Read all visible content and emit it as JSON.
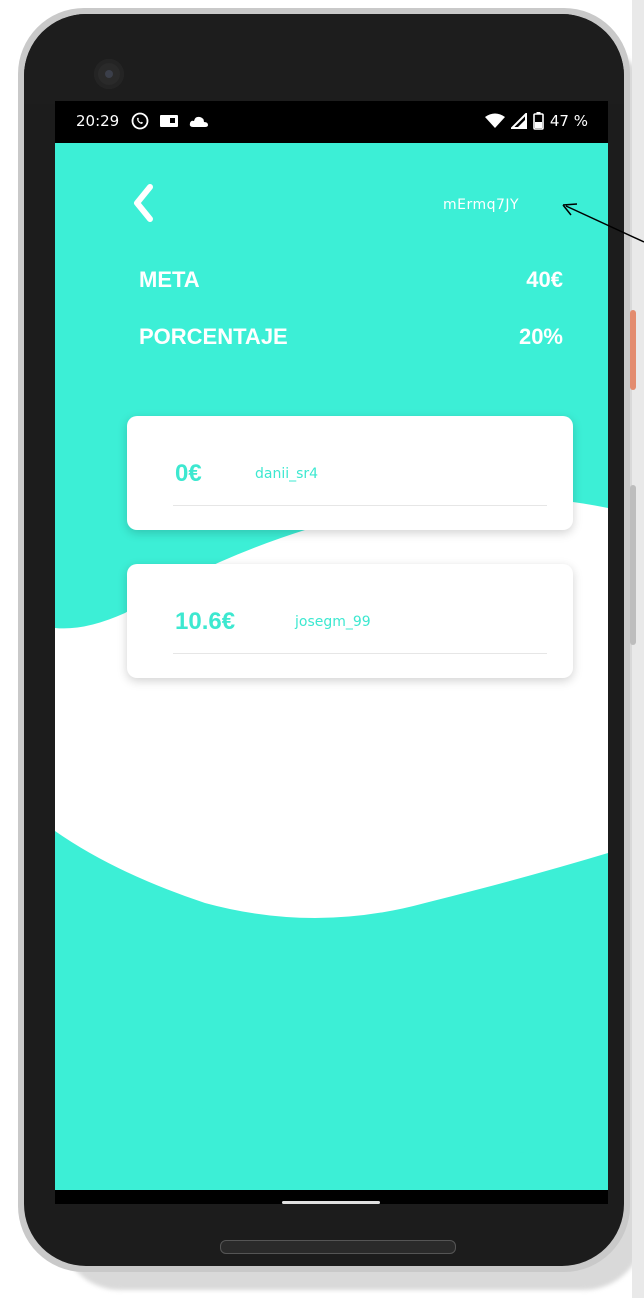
{
  "status_bar": {
    "time": "20:29",
    "battery": "47 %",
    "left_icons": [
      "whatsapp-icon",
      "cast-icon",
      "cloud-icon"
    ],
    "right_icons": [
      "wifi-icon",
      "signal-icon",
      "battery-icon"
    ]
  },
  "header": {
    "code": "mErmq7JY"
  },
  "summary": {
    "goal_label": "META",
    "goal_value": "40€",
    "percent_label": "PORCENTAJE",
    "percent_value": "20%"
  },
  "contributions": [
    {
      "amount": "0€",
      "user": "danii_sr4"
    },
    {
      "amount": "10.6€",
      "user": "josegm_99"
    }
  ],
  "colors": {
    "accent": "#3de8d0",
    "background": "#ffffff",
    "status_bar": "#000000"
  }
}
